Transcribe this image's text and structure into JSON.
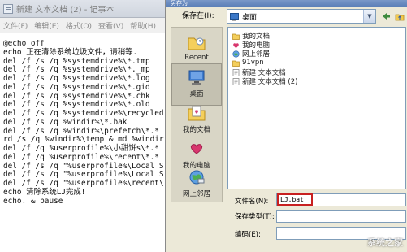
{
  "notepad": {
    "title": "新建 文本文档 (2) - 记事本",
    "menu": [
      "文件(F)",
      "编辑(E)",
      "格式(O)",
      "查看(V)",
      "帮助(H)"
    ],
    "lines": [
      "@echo off",
      "echo 正在清除系统垃圾文件，请稍等.",
      "del /f /s /q %systemdrive%\\*.tmp",
      "del /f /s /q %systemdrive%\\*._mp",
      "del /f /s /q %systemdrive%\\*.log",
      "del /f /s /q %systemdrive%\\*.gid",
      "del /f /s /q %systemdrive%\\*.chk",
      "del /f /s /q %systemdrive%\\*.old",
      "del /f /s /q %systemdrive%\\recycled",
      "del /f /s /q %windir%\\*.bak",
      "del /f /s /q %windir%\\prefetch\\*.*",
      "rd /s /q %windir%\\temp & md %windir",
      "del /f /q %userprofile%\\小甜饼s\\*.*",
      "del /f /q %userprofile%\\recent\\*.*",
      "del /f /s /q \"%userprofile%\\Local S",
      "del /f /s /q \"%userprofile%\\Local S",
      "del /f /s /q \"%userprofile%\\recent\\",
      "echo 清除系统LJ完成!",
      "echo. & pause"
    ]
  },
  "dialog": {
    "title": "另存为",
    "save_in_label": "保存在(I):",
    "save_in_value": "桌面",
    "places": [
      "Recent",
      "桌面",
      "我的文档",
      "我的电脑",
      "网上邻居"
    ],
    "files": [
      "我的文档",
      "我的电脑",
      "网上邻居",
      "91vpn",
      "新建 文本文档",
      "新建 文本文档 (2)"
    ],
    "filename_label": "文件名(N):",
    "filename_value": "LJ.bat",
    "filetype_label": "保存类型(T):",
    "encoding_label": "编码(E):"
  },
  "watermark": "系统之家"
}
